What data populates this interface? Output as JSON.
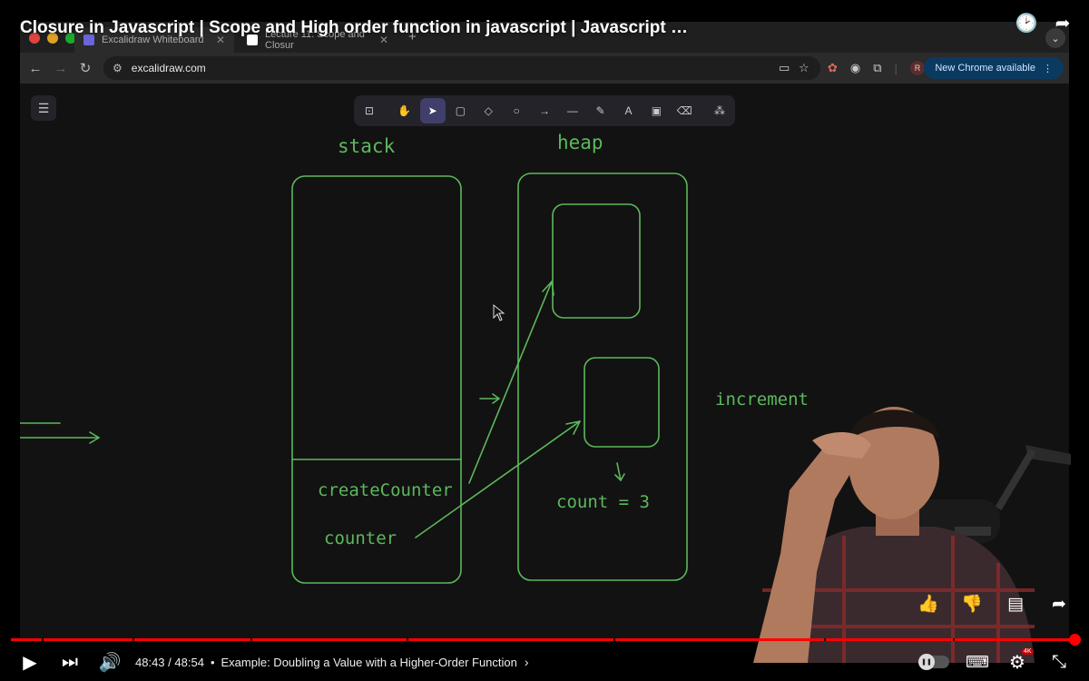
{
  "video": {
    "title": "Closure in Javascript | Scope and High order function in javascript | Javascript …"
  },
  "browser": {
    "tabs": [
      {
        "label": "Excalidraw Whiteboard"
      },
      {
        "label": "Lecture 11: Scope and Closur"
      }
    ],
    "new_tab": "+",
    "url": "excalidraw.com",
    "profile_initial": "R",
    "chrome_update": "New Chrome available"
  },
  "board": {
    "labels": {
      "stack": "stack",
      "heap": "heap",
      "increment": "increment",
      "createCounter": "createCounter",
      "counter": "counter",
      "count": "count = 3"
    }
  },
  "player": {
    "current_time": "48:43",
    "separator": " / ",
    "duration": "48:54",
    "chapter": "Example: Doubling a Value with a Higher-Order Function",
    "progress": 0.9962,
    "quality_badge": "4K",
    "icons": {
      "watch_later": "clock-icon",
      "share_top": "share-icon",
      "like": "thumbs-up-icon",
      "dislike": "thumbs-down-icon",
      "save": "save-icon",
      "share": "share-icon",
      "play": "play-icon",
      "next": "next-icon",
      "volume": "volume-icon",
      "autoplay": "autoplay-toggle",
      "subtitles": "subtitles-icon",
      "settings": "gear-icon",
      "fullscreen": "exit-fullscreen-icon"
    }
  },
  "colors": {
    "ink": "#5cb85c",
    "progress": "#ff0000",
    "tool_active": "#403e6a",
    "chrome_update_bg": "#0b3a61"
  }
}
